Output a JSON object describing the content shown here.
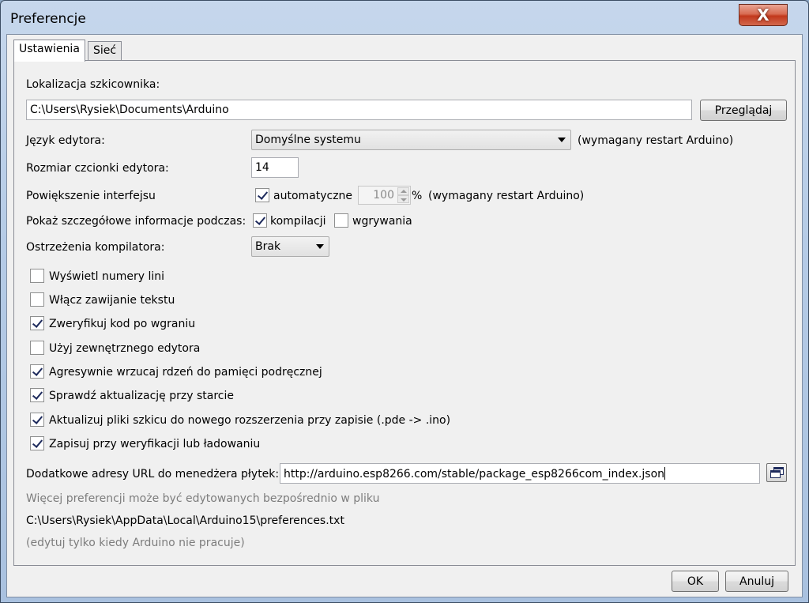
{
  "window": {
    "title": "Preferencje",
    "close_label": "X"
  },
  "tabs": [
    {
      "label": "Ustawienia",
      "active": true
    },
    {
      "label": "Sieć",
      "active": false
    }
  ],
  "sketchbook": {
    "label": "Lokalizacja szkicownika:",
    "path": "C:\\Users\\Rysiek\\Documents\\Arduino",
    "browse_label": "Przeglądaj"
  },
  "editor_language": {
    "label": "Język edytora:",
    "selected": "Domyślne systemu",
    "note": "(wymagany restart Arduino)"
  },
  "font_size": {
    "label": "Rozmiar czcionki edytora:",
    "value": "14"
  },
  "interface_scale": {
    "label": "Powiększenie interfejsu",
    "auto_label": "automatyczne",
    "auto_checked": true,
    "value": "100",
    "unit": "%",
    "note": "(wymagany restart Arduino)"
  },
  "verbose": {
    "label": "Pokaż szczegółowe informacje podczas:",
    "compile_label": "kompilacji",
    "compile_checked": true,
    "upload_label": "wgrywania",
    "upload_checked": false
  },
  "compiler_warnings": {
    "label": "Ostrzeżenia kompilatora:",
    "selected": "Brak"
  },
  "options": [
    {
      "label": "Wyświetl numery lini",
      "checked": false
    },
    {
      "label": "Włącz zawijanie tekstu",
      "checked": false
    },
    {
      "label": "Zweryfikuj kod po wgraniu",
      "checked": true
    },
    {
      "label": "Użyj zewnętrznego edytora",
      "checked": false
    },
    {
      "label": "Agresywnie wrzucaj rdzeń do pamięci podręcznej",
      "checked": true
    },
    {
      "label": "Sprawdź aktualizację przy starcie",
      "checked": true
    },
    {
      "label": "Aktualizuj pliki szkicu do nowego rozszerzenia przy zapisie (.pde -> .ino)",
      "checked": true
    },
    {
      "label": "Zapisuj przy weryfikacji lub ładowaniu",
      "checked": true
    }
  ],
  "boards_url": {
    "label": "Dodatkowe adresy URL do menedżera płytek:",
    "value": "http://arduino.esp8266.com/stable/package_esp8266com_index.json"
  },
  "footer_info": {
    "more_prefs": "Więcej preferencji może być edytowanych bezpośrednio w pliku",
    "prefs_path": "C:\\Users\\Rysiek\\AppData\\Local\\Arduino15\\preferences.txt",
    "edit_note": "(edytuj tylko kiedy Arduino nie pracuje)"
  },
  "buttons": {
    "ok": "OK",
    "cancel": "Anuluj"
  },
  "icons": {
    "close": "close-icon",
    "dropdown": "chevron-down-icon",
    "window_list": "window-list-icon",
    "checkbox": "checkmark-icon"
  }
}
